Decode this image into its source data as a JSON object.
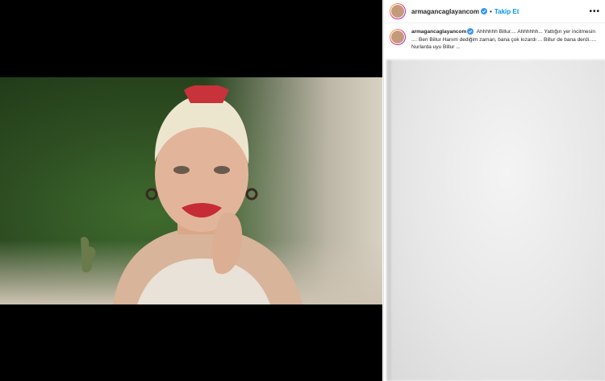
{
  "post": {
    "username": "armagancaglayancom",
    "follow_label": "Takip Et",
    "dot": "•",
    "more_label": "•••"
  },
  "caption": {
    "username": "armagancaglayancom",
    "text": "Ahhhhhh Billur.... Ahhhhhh... Yattığın yer incitmesin .... Ben Billur Hanım dediğim zaman, bana çok kızardı ... Billur de bana derdi..... Nurlarda uyu Billur ..."
  },
  "colors": {
    "follow": "#0095f6",
    "verified": "#3897f0",
    "text": "#262626"
  },
  "icons": {
    "verified": "verified-badge-icon",
    "more": "more-options-icon"
  }
}
